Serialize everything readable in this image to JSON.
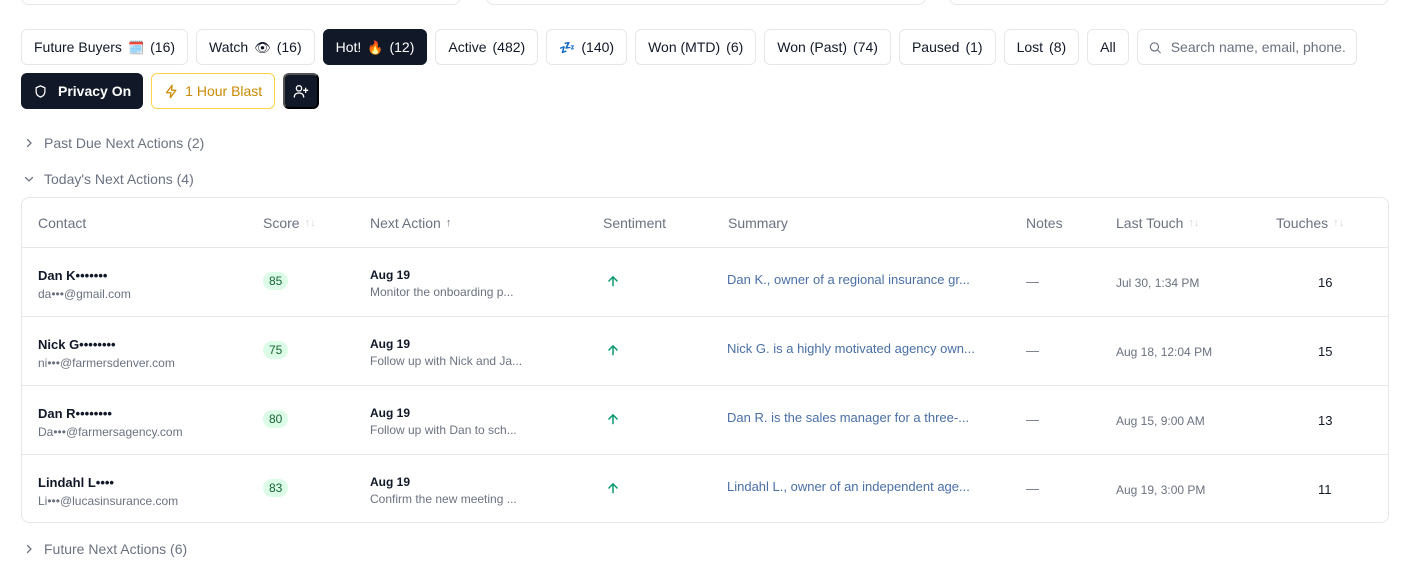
{
  "filters": [
    {
      "label": "Future Buyers",
      "emoji": "🗓️",
      "count": "(16)",
      "active": false
    },
    {
      "label": "Watch",
      "emoji": "👁",
      "count": "(16)",
      "active": false
    },
    {
      "label": "Hot!",
      "emoji": "🔥",
      "count": "(12)",
      "active": true
    },
    {
      "label": "Active",
      "emoji": "",
      "count": "(482)",
      "active": false
    },
    {
      "label": "",
      "emoji": "💤",
      "count": "(140)",
      "active": false
    },
    {
      "label": "Won (MTD)",
      "emoji": "",
      "count": "(6)",
      "active": false
    },
    {
      "label": "Won (Past)",
      "emoji": "",
      "count": "(74)",
      "active": false
    },
    {
      "label": "Paused",
      "emoji": "",
      "count": "(1)",
      "active": false
    },
    {
      "label": "Lost",
      "emoji": "",
      "count": "(8)",
      "active": false
    },
    {
      "label": "All",
      "emoji": "",
      "count": "",
      "active": false
    }
  ],
  "search": {
    "placeholder": "Search name, email, phone..."
  },
  "actions": {
    "privacy_label": "Privacy On",
    "blast_label": "1 Hour Blast"
  },
  "sections": {
    "past_due": "Past Due Next Actions (2)",
    "today": "Today's Next Actions (4)",
    "future": "Future Next Actions (6)"
  },
  "table": {
    "headers": {
      "contact": "Contact",
      "score": "Score",
      "next_action": "Next Action",
      "sentiment": "Sentiment",
      "summary": "Summary",
      "notes": "Notes",
      "last_touch": "Last Touch",
      "touches": "Touches"
    },
    "rows": [
      {
        "name": "Dan K•••••••",
        "email": "da•••@gmail.com",
        "score": "85",
        "date": "Aug 19",
        "next": "Monitor the onboarding p...",
        "sentiment": "up",
        "summary": "Dan K., owner of a regional insurance gr...",
        "notes": "—",
        "last_touch": "Jul 30, 1:34 PM",
        "touches": "16"
      },
      {
        "name": "Nick G••••••••",
        "email": "ni•••@farmersdenver.com",
        "score": "75",
        "date": "Aug 19",
        "next": "Follow up with Nick and Ja...",
        "sentiment": "up",
        "summary": "Nick G. is a highly motivated agency own...",
        "notes": "—",
        "last_touch": "Aug 18, 12:04 PM",
        "touches": "15"
      },
      {
        "name": "Dan R••••••••",
        "email": "Da•••@farmersagency.com",
        "score": "80",
        "date": "Aug 19",
        "next": "Follow up with Dan to sch...",
        "sentiment": "up",
        "summary": "Dan R. is the sales manager for a three-...",
        "notes": "—",
        "last_touch": "Aug 15, 9:00 AM",
        "touches": "13"
      },
      {
        "name": "Lindahl L••••",
        "email": "Li•••@lucasinsurance.com",
        "score": "83",
        "date": "Aug 19",
        "next": "Confirm the new meeting ...",
        "sentiment": "up",
        "summary": "Lindahl L., owner of an independent age...",
        "notes": "—",
        "last_touch": "Aug 19, 3:00 PM",
        "touches": "11"
      }
    ]
  },
  "colors": {
    "accent": "#111827",
    "score_bg": "#dcfce7",
    "score_text": "#166534",
    "sentiment_up": "#059669",
    "summary_link": "#4a6fa5",
    "blast": "#ca8a04"
  }
}
